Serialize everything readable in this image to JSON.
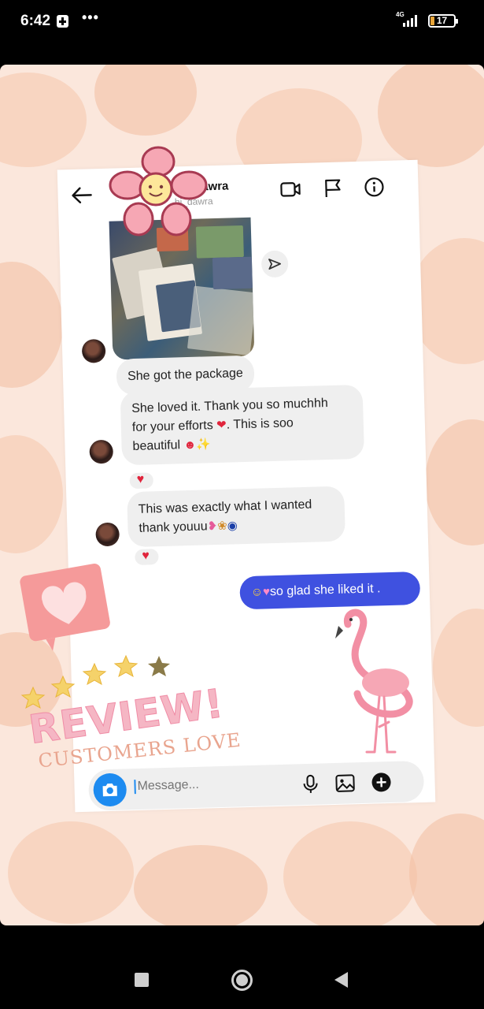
{
  "status_bar": {
    "time": "6:42",
    "network": "4G",
    "battery_level": "17",
    "battery_fraction": 0.17
  },
  "chat": {
    "contact_name": "Dawra",
    "contact_handle": "hi_dawra",
    "messages": [
      {
        "from": "contact",
        "type": "photo"
      },
      {
        "from": "contact",
        "text": "She got the package"
      },
      {
        "from": "contact",
        "text_a": "She loved it. Thank you so muchhh",
        "text_b": "for your efforts",
        "text_c": ". This is soo",
        "text_d": "beautiful",
        "reaction": "heart"
      },
      {
        "from": "contact",
        "text_a": "This was exactly what I wanted",
        "text_b": "thank youuu",
        "reaction": "heart"
      },
      {
        "from": "me",
        "text": "so glad she liked it ."
      }
    ],
    "composer": {
      "placeholder": "Message..."
    }
  },
  "stickers": {
    "review": "REVIEW!",
    "customer_love": "CUSTOMERS LOVE"
  },
  "colors": {
    "sent_bubble": "#3f51e0",
    "received_bubble": "#efefef",
    "camera_button": "#1d8bf0",
    "reaction_heart": "#e0243c",
    "backdrop": "#fbe7dc"
  }
}
